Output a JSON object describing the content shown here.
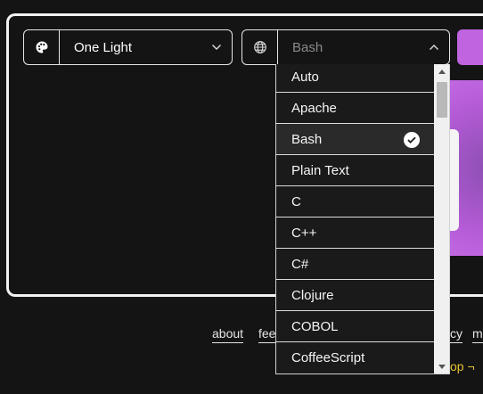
{
  "theme_select": {
    "icon": "palette-icon",
    "value": "One Light",
    "chevron": "chevron-down-icon"
  },
  "language_select": {
    "icon": "globe-icon",
    "placeholder": "Bash",
    "chevron": "chevron-up-icon"
  },
  "dropdown": {
    "items": [
      {
        "label": "Auto"
      },
      {
        "label": "Apache"
      },
      {
        "label": "Bash",
        "selected": true
      },
      {
        "label": "Plain Text"
      },
      {
        "label": "C"
      },
      {
        "label": "C++"
      },
      {
        "label": "C#"
      },
      {
        "label": "Clojure"
      },
      {
        "label": "COBOL"
      },
      {
        "label": "CoffeeScript"
      }
    ],
    "selected_icon": "checkmark-icon"
  },
  "footer": {
    "links": [
      "about",
      "fee",
      "cy",
      "m"
    ],
    "partial_text": "op ¬"
  },
  "colors": {
    "accent": "#c064e0",
    "background": "#141414",
    "link_yellow": "#e8c232"
  }
}
